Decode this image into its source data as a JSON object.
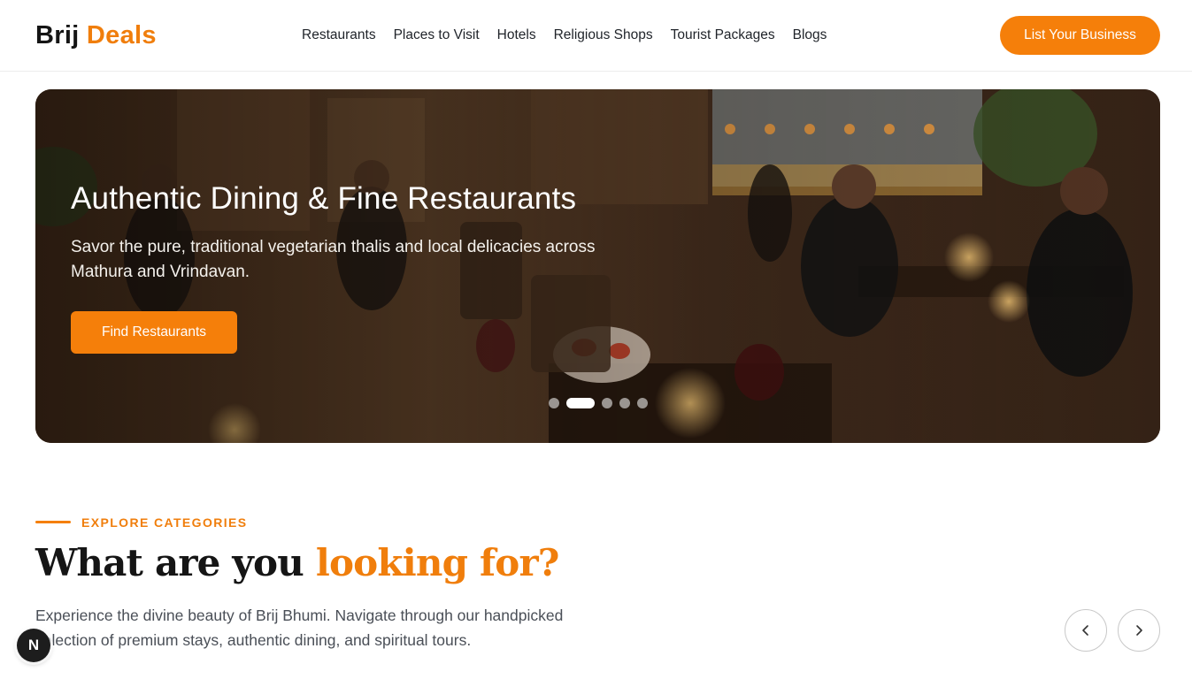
{
  "header": {
    "logo_part1": "Brij",
    "logo_part2": "Deals",
    "nav": [
      "Restaurants",
      "Places to Visit",
      "Hotels",
      "Religious Shops",
      "Tourist Packages",
      "Blogs"
    ],
    "cta_label": "List Your Business"
  },
  "hero": {
    "title": "Authentic Dining & Fine Restaurants",
    "subtitle": "Savor the pure, traditional vegetarian thalis and local delicacies across Mathura and Vrindavan.",
    "button_label": "Find Restaurants",
    "slides_total": 5,
    "active_slide": 2
  },
  "categories": {
    "eyebrow": "EXPLORE CATEGORIES",
    "heading_part1": "What are you ",
    "heading_part2": "looking for?",
    "description": "Experience the divine beauty of Brij Bhumi. Navigate through our handpicked selection of premium stays, authentic dining, and spiritual tours."
  },
  "colors": {
    "accent": "#f57f0a",
    "text": "#1f2329"
  },
  "icons": {
    "prev": "chevron-left-icon",
    "next": "chevron-right-icon",
    "dev_badge": "N"
  }
}
